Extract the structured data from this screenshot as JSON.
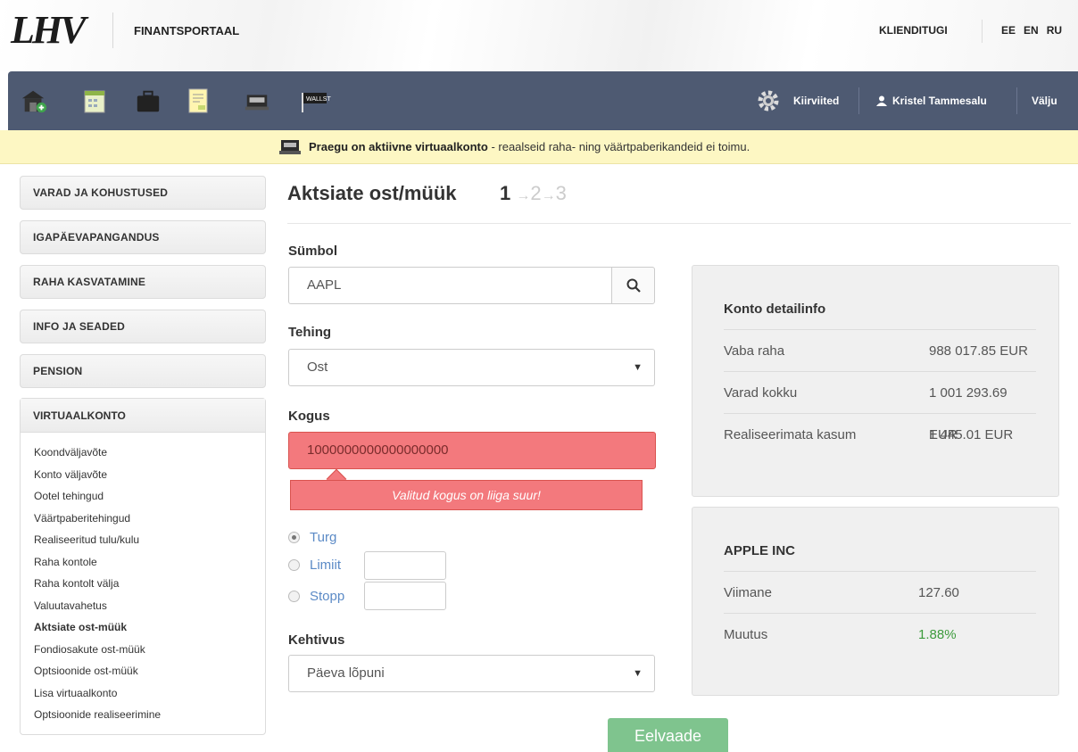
{
  "header": {
    "logo": "LHV",
    "portal_title": "FINANTSPORTAAL",
    "support": "KLIENDITUGI",
    "languages": [
      "EE",
      "EN",
      "RU"
    ]
  },
  "navbar": {
    "icons": [
      "home-icon",
      "calendar-icon",
      "briefcase-icon",
      "document-icon",
      "virtual-account-icon",
      "wallst-icon"
    ],
    "wallst_label": "WALLST",
    "shortcuts": "Kiirviited",
    "user": "Kristel Tammesalu",
    "logout": "Välju",
    "bar_color": "#4e5a72"
  },
  "banner": {
    "bold": "Praegu on aktiivne virtuaalkonto",
    "rest": " - reaalseid raha- ning väärtpaberikandeid ei toimu.",
    "color": "#fdf7c3"
  },
  "sidebar": {
    "sections": [
      "VARAD JA KOHUSTUSED",
      "IGAPÄEVAPANGANDUS",
      "RAHA KASVATAMINE",
      "INFO JA SEADED",
      "PENSION"
    ],
    "virtual": {
      "title": "VIRTUAALKONTO",
      "items": [
        "Koondväljavõte",
        "Konto väljavõte",
        "Ootel tehingud",
        "Väärtpaberitehingud",
        "Realiseeritud tulu/kulu",
        "Raha kontole",
        "Raha kontolt välja",
        "Valuutavahetus",
        "Aktsiate ost-müük",
        "Fondiosakute ost-müük",
        "Optsioonide ost-müük",
        "Lisa virtuaalkonto",
        "Optsioonide realiseerimine"
      ],
      "active": "Aktsiate ost-müük"
    }
  },
  "main": {
    "title": "Aktsiate ost/müük",
    "steps": {
      "current": "1",
      "next1": "2",
      "next2": "3"
    },
    "symbol_label": "Sümbol",
    "symbol_value": "AAPL",
    "transaction_label": "Tehing",
    "transaction_value": "Ost",
    "quantity_label": "Kogus",
    "quantity_value": "1000000000000000000",
    "quantity_error": "Valitud kogus on liiga suur!",
    "order_types": [
      "Turg",
      "Limiit",
      "Stopp"
    ],
    "order_selected": "Turg",
    "validity_label": "Kehtivus",
    "validity_value": "Päeva lõpuni",
    "preview_button": "Eelvaade",
    "error_color": "#f3797d",
    "button_color": "#7fc48e"
  },
  "account_panel": {
    "title": "Konto detailinfo",
    "rows": [
      {
        "label": "Vaba raha",
        "value": "988 017.85 EUR"
      },
      {
        "label": "Varad kokku",
        "value": "1 001 293.69 EUR"
      },
      {
        "label": "Realiseerimata kasum",
        "value": "1 445.01 EUR"
      }
    ]
  },
  "stock_panel": {
    "title": "APPLE INC",
    "rows": [
      {
        "label": "Viimane",
        "value": "127.60"
      },
      {
        "label": "Muutus",
        "value": "1.88%"
      }
    ],
    "positive_color": "#3c9b3c"
  }
}
